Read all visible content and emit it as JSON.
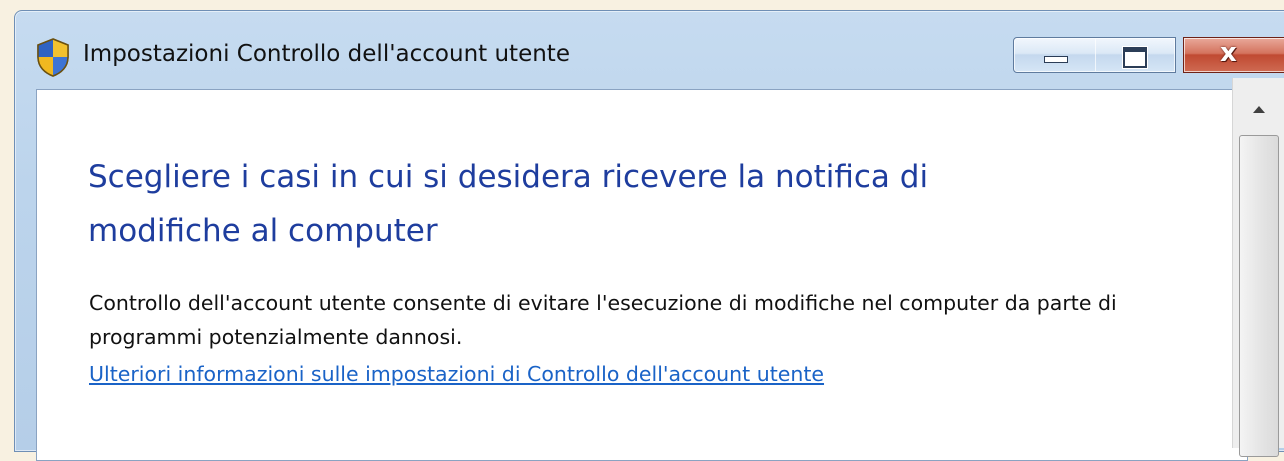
{
  "window": {
    "title": "Impostazioni Controllo dell'account utente",
    "icon": "uac-shield-icon",
    "controls": {
      "minimize_icon": "minimize-icon",
      "maximize_icon": "maximize-icon",
      "close_label": "x",
      "close_color": "#c04a32"
    }
  },
  "main": {
    "heading": "Scegliere i casi in cui si desidera ricevere la notifica di modifiche al computer",
    "description": "Controllo dell'account utente consente di evitare l'esecuzione di modifiche nel computer da parte di programmi potenzialmente dannosi.",
    "link_text": "Ulteriori informazioni sulle impostazioni di Controllo dell'account utente"
  },
  "colors": {
    "heading": "#1e3d9e",
    "link": "#1a63c7",
    "titlebar": "#bcd4ec"
  }
}
